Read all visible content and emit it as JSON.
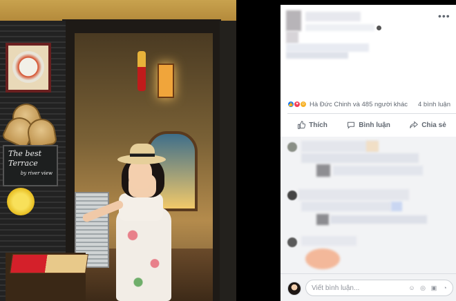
{
  "photo": {
    "sign_line1": "The best",
    "sign_line2": "Terrace",
    "sign_line3": "by river view"
  },
  "post": {
    "reactions": {
      "icons": [
        "like-icon",
        "love-icon",
        "haha-icon"
      ],
      "summary": "Hà Đức Chinh và 485 người khác",
      "comment_count": "4 bình luận"
    },
    "actions": {
      "like": "Thích",
      "comment": "Bình luận",
      "share": "Chia sẻ"
    },
    "compose": {
      "placeholder": "Viết bình luận..."
    }
  },
  "colors": {
    "like_blue": "#1877f2",
    "love_red": "#f33e58",
    "haha_yellow": "#f7b125",
    "text_gray": "#606770"
  }
}
